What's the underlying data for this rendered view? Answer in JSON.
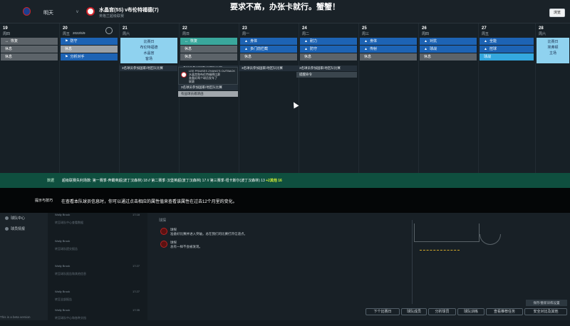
{
  "top": {
    "today": "明天",
    "vs": "v",
    "match": "水晶宫(5S) v布伦特福德(7)",
    "competition": "英格兰超级联赛",
    "banner": "要求不高，办张卡就行。蟹蟹！",
    "continue": "浏览"
  },
  "calendar": {
    "days": [
      {
        "num": "19",
        "name": "周四"
      },
      {
        "num": "20",
        "name": "周五",
        "date": "2022/5/9"
      },
      {
        "num": "21",
        "name": "周六"
      },
      {
        "num": "22",
        "name": "周日"
      },
      {
        "num": "23",
        "name": "周一"
      },
      {
        "num": "24",
        "name": "周二"
      },
      {
        "num": "25",
        "name": "周三"
      },
      {
        "num": "26",
        "name": "周四"
      },
      {
        "num": "27",
        "name": "周五"
      },
      {
        "num": "28",
        "name": "周六"
      }
    ],
    "day0": [
      "恢复",
      "休息",
      "休息"
    ],
    "day1": [
      "防守",
      "休息",
      "分析对手"
    ],
    "day2": {
      "title": "比赛日",
      "line1": "布伦特福德",
      "line2": "水晶宫",
      "line3": "客场"
    },
    "day3": [
      "恢复",
      "休息",
      "休息"
    ],
    "day4": [
      "身体",
      "多门前拦截",
      "休息"
    ],
    "day5": [
      "耐力",
      "防守",
      "休息"
    ],
    "day6": [
      "身体",
      "传射",
      "休息"
    ],
    "day7": [
      "对抗",
      "球战",
      "休息"
    ],
    "day8": [
      "全能",
      "控球",
      "球战"
    ],
    "day9": {
      "line1": "比赛日",
      "line2": "埃弗顿",
      "line3": "主场"
    },
    "events": [
      "3名球员参加国家/地区队比赛",
      "3名球员参加国家/地区队比赛",
      "3名球员参加国家/地区队比赛",
      "3名球员参加国家/地区队比赛",
      "提醒命令",
      "3名球员参加国家/地区队比赛",
      "有益球员邀请函"
    ],
    "popup": [
      "LEE PRAISES ZHANG'S OUTBACK",
      "水晶宫和布伦特福德比赛",
      "准备好两个球员发车了",
      "联赛"
    ]
  },
  "progress": {
    "label": "数据",
    "text": "超级联赛失利场数: 第一赛季·奔霸英超(波丁汉森林) 18 // 第二赛季·汉堡英超(波丁汉森林) 17 // 第三赛季·纽卡斯尔(波丁汉森林) 13",
    "extra": "+2其他 16"
  },
  "tip": {
    "label": "提示与技巧",
    "text": "在查看本队球员信息时，你可以通过点击相应的属性值来查看该属性在过去12个月里的变化。"
  },
  "menu": {
    "items": [
      "球队中心",
      "球员情报"
    ],
    "beta": "This is a beta version"
  },
  "messages": [
    {
      "sender": "Wally Brook",
      "text": "转至球队中心查看数据",
      "time": "17:18"
    },
    {
      "sender": "Wally Brook",
      "text": "转至球队提交报告",
      "time": ""
    },
    {
      "sender": "Wally Brook",
      "text": "转至球队报告和其他信息",
      "time": "17:27"
    },
    {
      "sender": "Wally Brook",
      "text": "转至全部报告",
      "time": "17:27"
    },
    {
      "sender": "Wally Brook",
      "text": "转至球队中心和各种文档",
      "time": "17:35"
    },
    {
      "sender": "Wally Brook",
      "text": "转至",
      "time": ""
    }
  ],
  "detail": {
    "feedback": "球探",
    "scouts": [
      {
        "name": "球探",
        "text": "准备好比赛并进入突破。总在我们的比赛打开信道点。"
      },
      {
        "name": "球探",
        "text": "总有一样不会被发现。"
      }
    ],
    "save": "保存/重新训练设置"
  },
  "footer": [
    "下个比赛日",
    "球队成员",
    "分析球员",
    "球队训练",
    "查看推荐任务",
    "安全对比及其他"
  ]
}
